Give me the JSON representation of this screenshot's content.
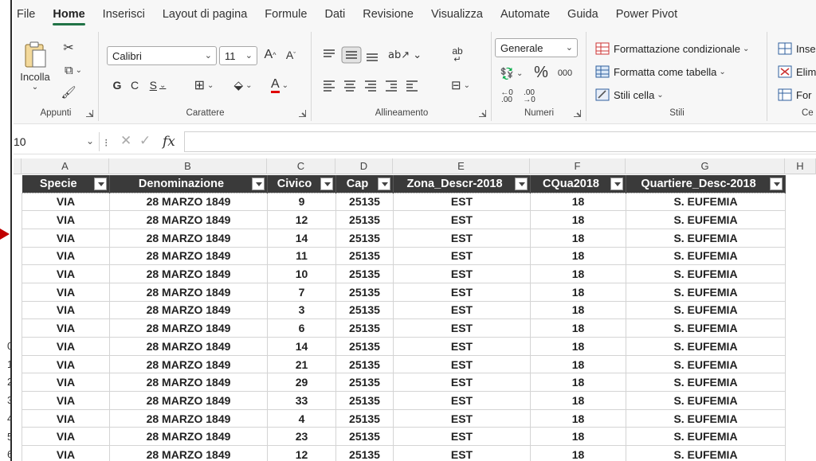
{
  "menu": {
    "tabs": [
      "File",
      "Home",
      "Inserisci",
      "Layout di pagina",
      "Formule",
      "Dati",
      "Revisione",
      "Visualizza",
      "Automate",
      "Guida",
      "Power Pivot"
    ],
    "active": "Home"
  },
  "ribbon": {
    "clipboard": {
      "paste_label": "Incolla",
      "group_label": "Appunti"
    },
    "font": {
      "name": "Calibri",
      "size": "11",
      "bold": "G",
      "italic": "C",
      "underline": "S",
      "group_label": "Carattere",
      "grow": "A",
      "shrink": "A",
      "color_letter": "A"
    },
    "alignment": {
      "group_label": "Allineamento",
      "wrap_glyph": "ab"
    },
    "number": {
      "format": "Generale",
      "percent": "%",
      "thousands": "000",
      "inc_dec": "←0 .00",
      "dec_dec": ".00 →0",
      "group_label": "Numeri"
    },
    "styles": {
      "conditional": "Formattazione condizionale",
      "as_table": "Formatta come tabella",
      "cell_styles": "Stili cella",
      "group_label": "Stili"
    },
    "cells": {
      "insert": "Inse",
      "delete": "Elim",
      "format": "For",
      "group_label": "Ce"
    }
  },
  "formula_bar": {
    "name_box": "10",
    "content": ""
  },
  "columns": [
    "A",
    "B",
    "C",
    "D",
    "E",
    "F",
    "G",
    "H"
  ],
  "table": {
    "headers": [
      "Specie",
      "Denominazione",
      "Civico",
      "Cap",
      "Zona_Descr-2018",
      "CQua2018",
      "Quartiere_Desc-2018"
    ],
    "rows": [
      [
        "VIA",
        "28 MARZO 1849",
        "9",
        "25135",
        "EST",
        "18",
        "S. EUFEMIA"
      ],
      [
        "VIA",
        "28 MARZO 1849",
        "12",
        "25135",
        "EST",
        "18",
        "S. EUFEMIA"
      ],
      [
        "VIA",
        "28 MARZO 1849",
        "14",
        "25135",
        "EST",
        "18",
        "S. EUFEMIA"
      ],
      [
        "VIA",
        "28 MARZO 1849",
        "11",
        "25135",
        "EST",
        "18",
        "S. EUFEMIA"
      ],
      [
        "VIA",
        "28 MARZO 1849",
        "10",
        "25135",
        "EST",
        "18",
        "S. EUFEMIA"
      ],
      [
        "VIA",
        "28 MARZO 1849",
        "7",
        "25135",
        "EST",
        "18",
        "S. EUFEMIA"
      ],
      [
        "VIA",
        "28 MARZO 1849",
        "3",
        "25135",
        "EST",
        "18",
        "S. EUFEMIA"
      ],
      [
        "VIA",
        "28 MARZO 1849",
        "6",
        "25135",
        "EST",
        "18",
        "S. EUFEMIA"
      ],
      [
        "VIA",
        "28 MARZO 1849",
        "14",
        "25135",
        "EST",
        "18",
        "S. EUFEMIA"
      ],
      [
        "VIA",
        "28 MARZO 1849",
        "21",
        "25135",
        "EST",
        "18",
        "S. EUFEMIA"
      ],
      [
        "VIA",
        "28 MARZO 1849",
        "29",
        "25135",
        "EST",
        "18",
        "S. EUFEMIA"
      ],
      [
        "VIA",
        "28 MARZO 1849",
        "33",
        "25135",
        "EST",
        "18",
        "S. EUFEMIA"
      ],
      [
        "VIA",
        "28 MARZO 1849",
        "4",
        "25135",
        "EST",
        "18",
        "S. EUFEMIA"
      ],
      [
        "VIA",
        "28 MARZO 1849",
        "23",
        "25135",
        "EST",
        "18",
        "S. EUFEMIA"
      ],
      [
        "VIA",
        "28 MARZO 1849",
        "12",
        "25135",
        "EST",
        "18",
        "S. EUFEMIA"
      ]
    ]
  },
  "row_number_fragments": [
    "0",
    "1",
    "2",
    "3",
    "4",
    "5",
    "6"
  ],
  "colors": {
    "header_fill": "#3a3a3a",
    "accent": "#217346",
    "arrow": "#c00000"
  }
}
